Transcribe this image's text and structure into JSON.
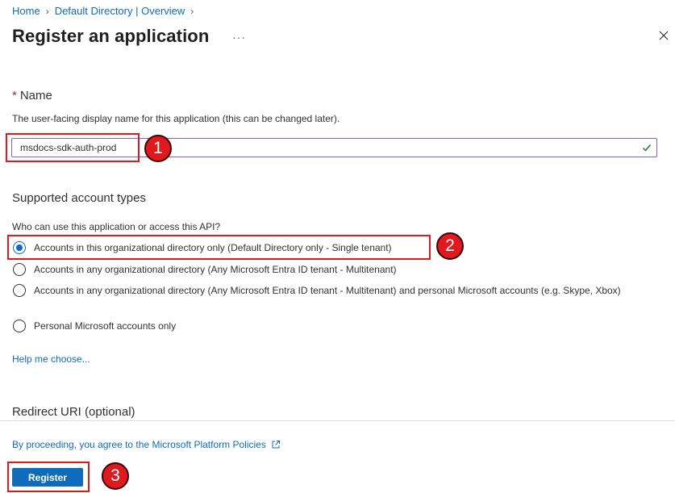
{
  "breadcrumb": {
    "items": [
      "Home",
      "Default Directory | Overview"
    ]
  },
  "header": {
    "title": "Register an application",
    "more_label": "···"
  },
  "name_section": {
    "required_marker": "*",
    "label": "Name",
    "description": "The user-facing display name for this application (this can be changed later).",
    "value": "msdocs-sdk-auth-prod"
  },
  "account_types": {
    "heading": "Supported account types",
    "question": "Who can use this application or access this API?",
    "options": [
      {
        "label": "Accounts in this organizational directory only (Default Directory only - Single tenant)",
        "checked": true
      },
      {
        "label": "Accounts in any organizational directory (Any Microsoft Entra ID tenant - Multitenant)",
        "checked": false
      },
      {
        "label": "Accounts in any organizational directory (Any Microsoft Entra ID tenant - Multitenant) and personal Microsoft accounts (e.g. Skype, Xbox)",
        "checked": false
      },
      {
        "label": "Personal Microsoft accounts only",
        "checked": false
      }
    ],
    "help_link": "Help me choose..."
  },
  "redirect": {
    "heading": "Redirect URI (optional)"
  },
  "footer": {
    "policy_text": "By proceeding, you agree to the Microsoft Platform Policies",
    "register_label": "Register"
  },
  "callouts": [
    "1",
    "2",
    "3"
  ],
  "colors": {
    "accent": "#0f6cbd",
    "callout_red": "#e0191e",
    "valid_green": "#107c10",
    "input_focus_border": "#8764b8"
  },
  "icons": [
    "chevron-right-icon",
    "more-icon",
    "close-icon",
    "checkmark-icon",
    "external-link-icon"
  ]
}
